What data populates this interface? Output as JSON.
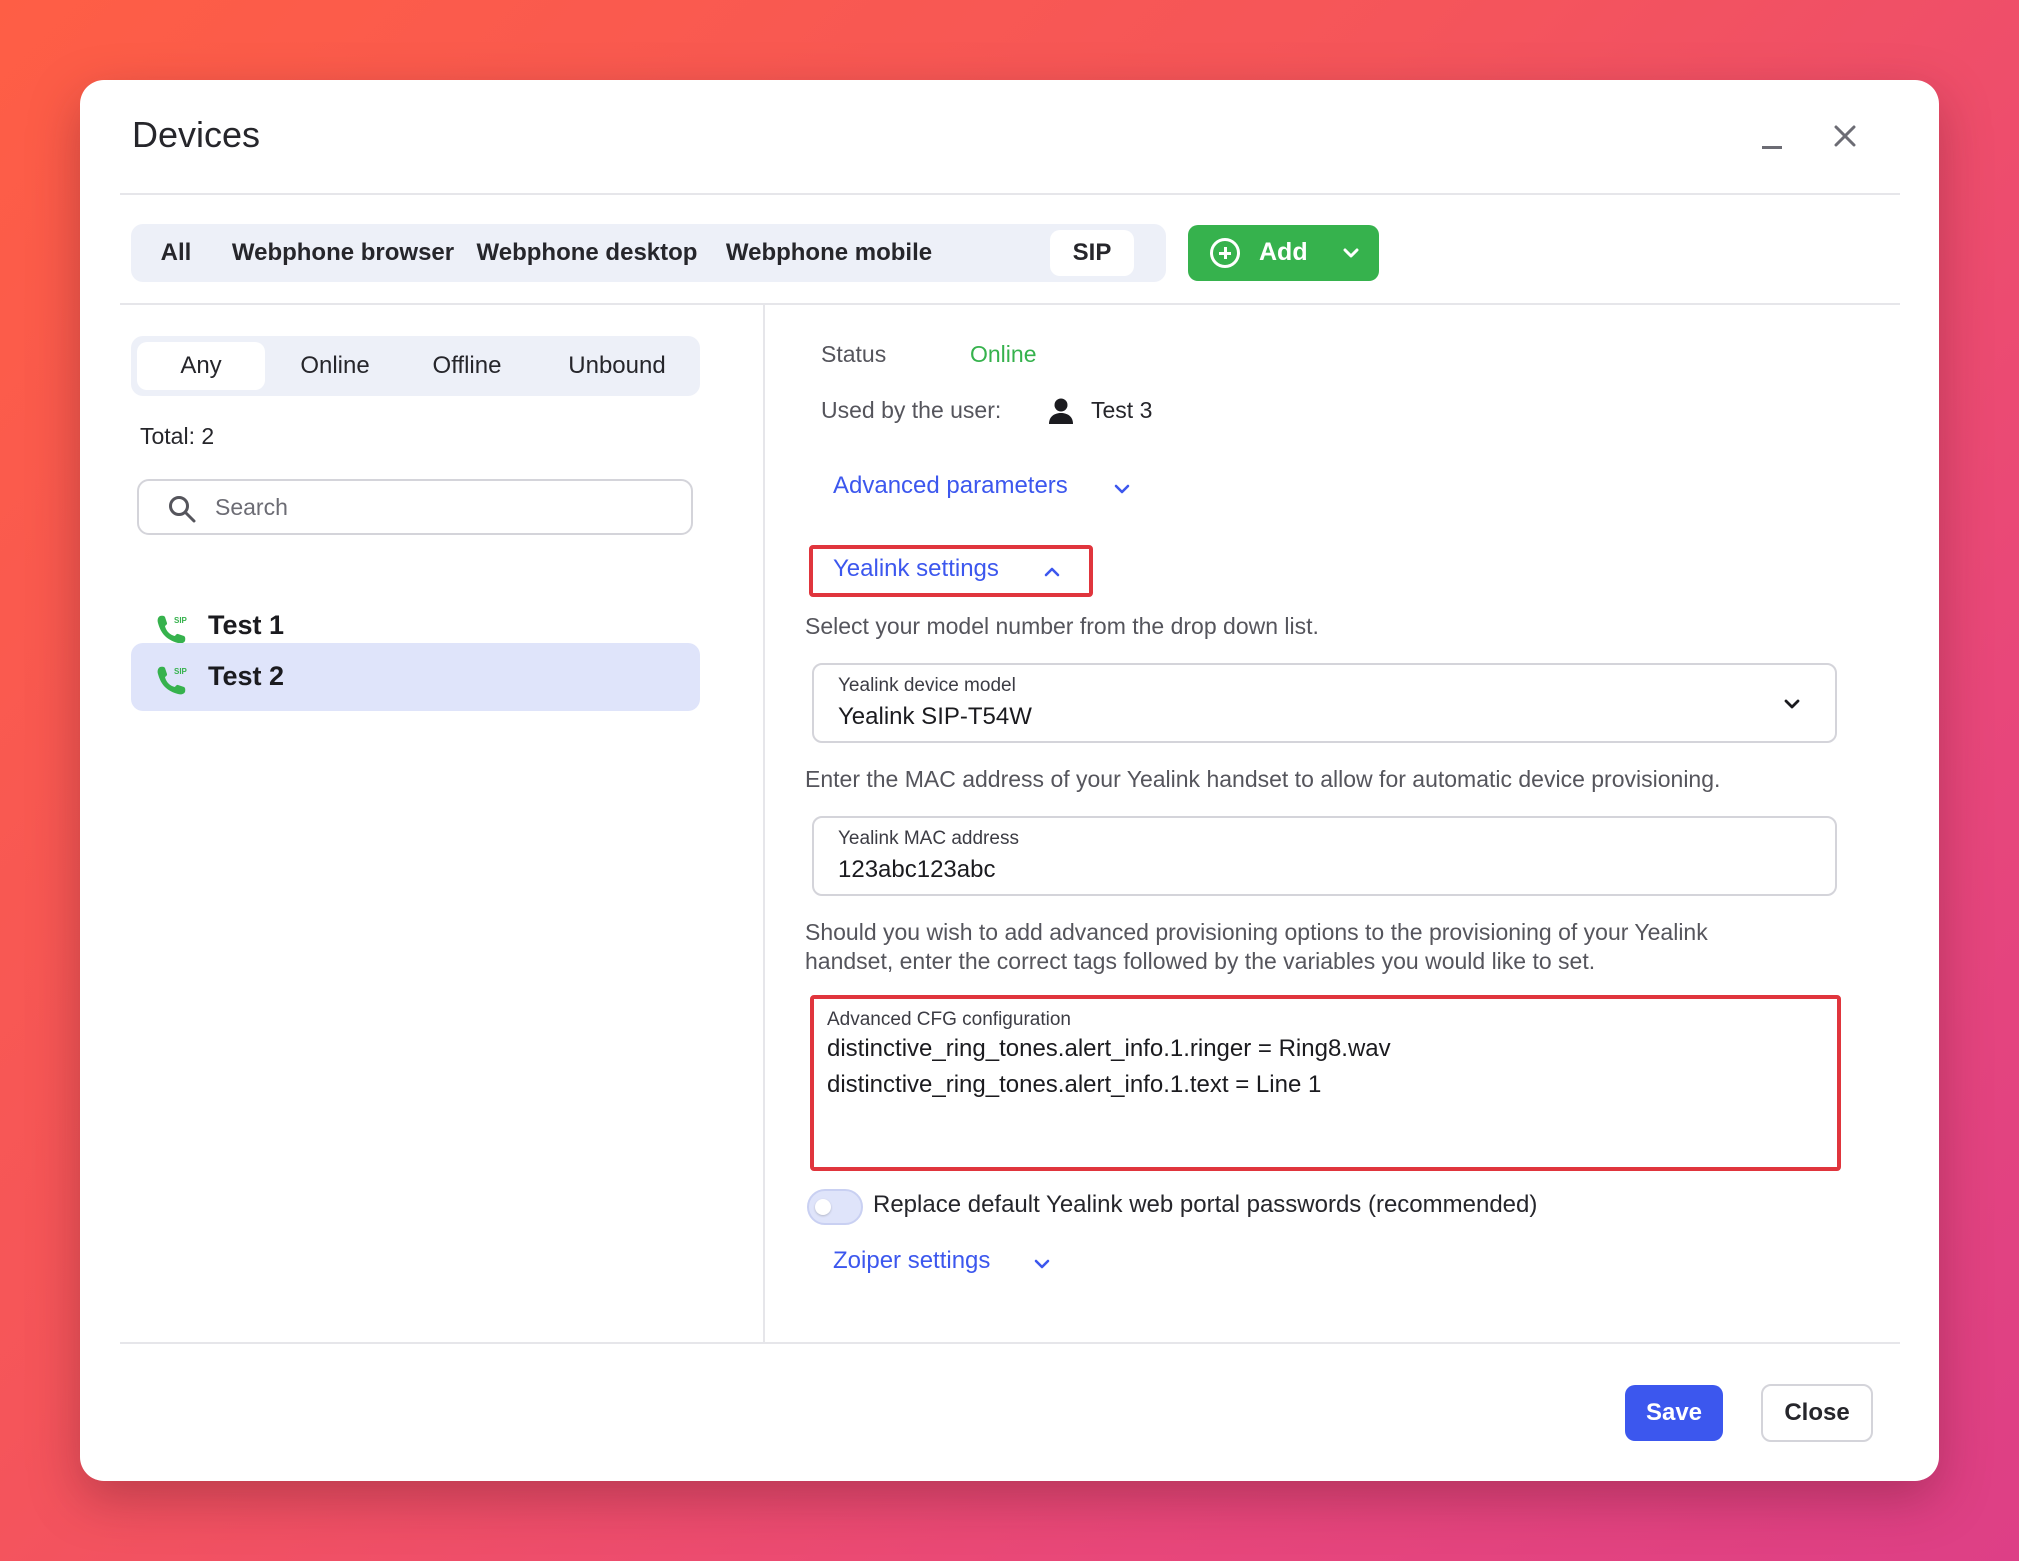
{
  "window": {
    "title": "Devices"
  },
  "device_tabs": [
    {
      "label": "All"
    },
    {
      "label": "Webphone browser"
    },
    {
      "label": "Webphone desktop"
    },
    {
      "label": "Webphone mobile"
    },
    {
      "label": "SIP",
      "active": true
    }
  ],
  "add_button": {
    "label": "Add"
  },
  "filters": [
    {
      "label": "Any",
      "active": true
    },
    {
      "label": "Online"
    },
    {
      "label": "Offline"
    },
    {
      "label": "Unbound"
    }
  ],
  "total_label": "Total: 2",
  "search": {
    "placeholder": "Search"
  },
  "devices": [
    {
      "name": "Test 1",
      "icon": "sip-phone-icon"
    },
    {
      "name": "Test 2",
      "icon": "sip-phone-icon",
      "selected": true
    }
  ],
  "details": {
    "status_label": "Status",
    "status_value": "Online",
    "status_color": "#36b24d",
    "used_by_label": "Used by the user:",
    "used_by_value": "Test 3",
    "advanced_parameters_link": "Advanced parameters",
    "yealink_settings_link": "Yealink settings",
    "model_desc": "Select your model number from the drop down list.",
    "model_field": {
      "label": "Yealink device model",
      "value": "Yealink SIP-T54W"
    },
    "mac_desc": "Enter the MAC address of your Yealink handset to allow for automatic device provisioning.",
    "mac_field": {
      "label": "Yealink MAC address",
      "value": "123abc123abc"
    },
    "cfg_desc_1": "Should you wish to add advanced provisioning options to the provisioning of your Yealink",
    "cfg_desc_2": "handset, enter the correct tags followed by the variables you would like to set.",
    "cfg_field": {
      "label": "Advanced CFG configuration",
      "lines": [
        "distinctive_ring_tones.alert_info.1.ringer = Ring8.wav",
        "distinctive_ring_tones.alert_info.1.text = Line 1"
      ]
    },
    "replace_passwords_label": "Replace default Yealink web portal passwords (recommended)",
    "replace_passwords_on": false,
    "zoiper_settings_link": "Zoiper settings"
  },
  "footer": {
    "save_label": "Save",
    "close_label": "Close"
  },
  "colors": {
    "accent": "#3c57ee",
    "add": "#36b24d",
    "highlight": "#e0353d"
  }
}
